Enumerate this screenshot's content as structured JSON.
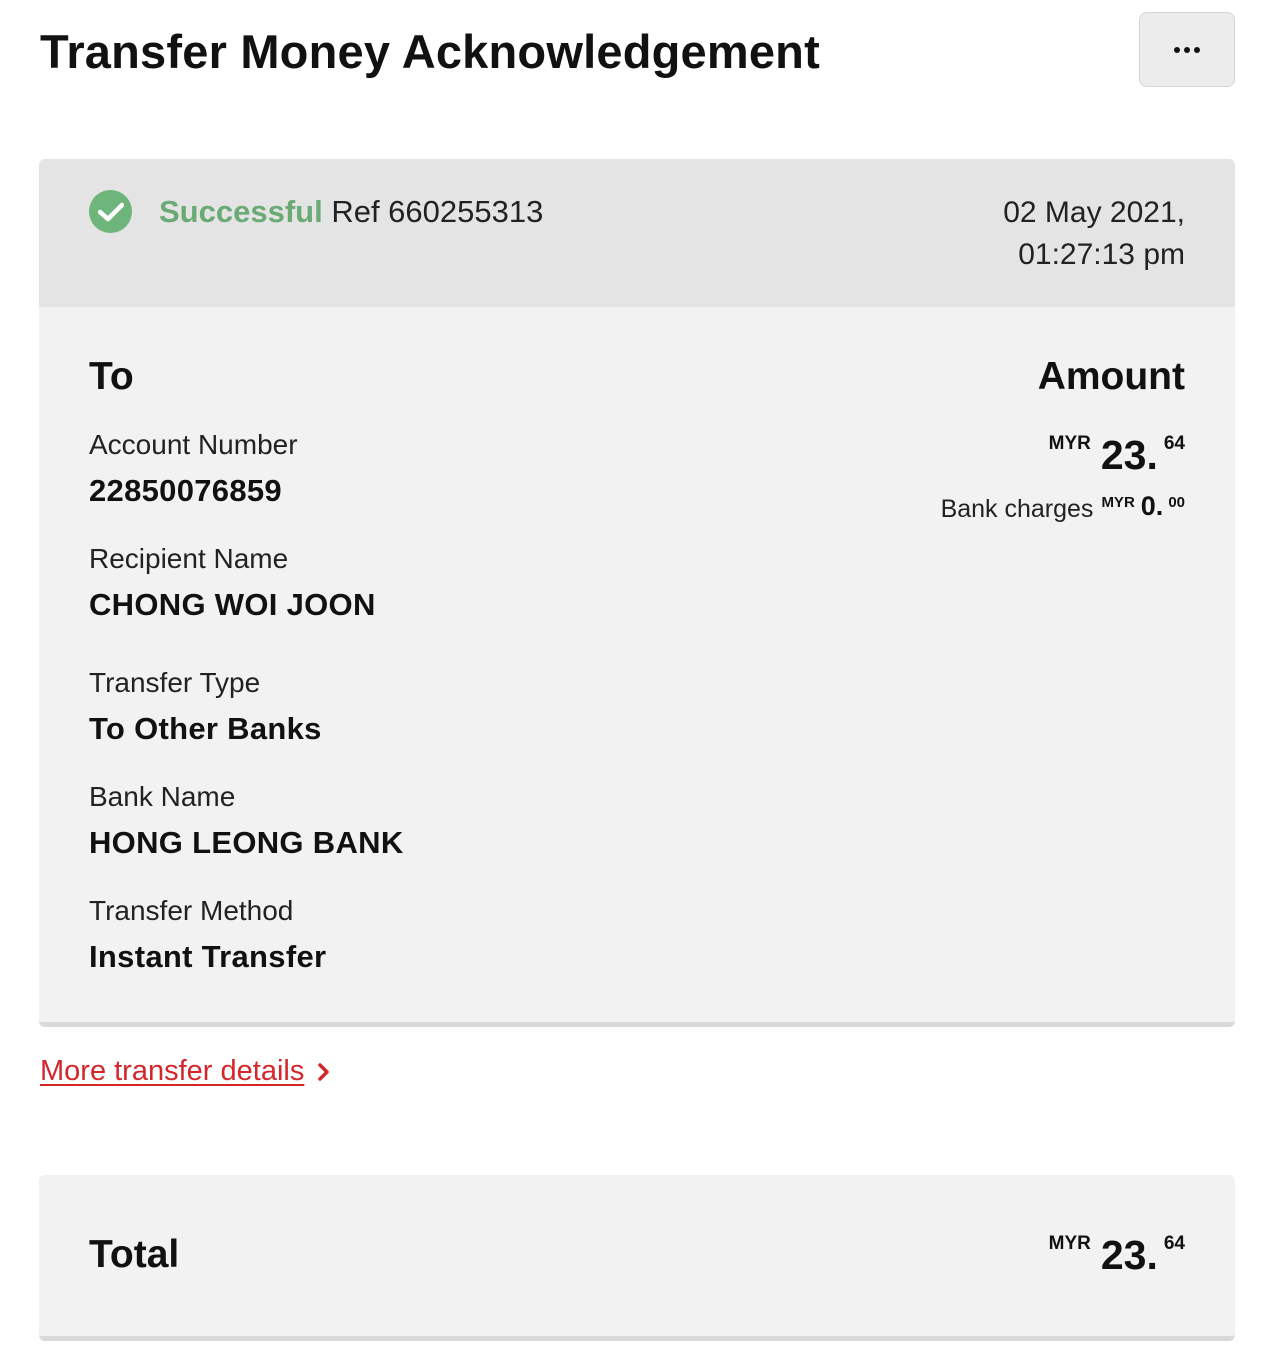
{
  "header": {
    "title": "Transfer Money Acknowledgement",
    "more_icon": "more-horizontal-icon"
  },
  "status": {
    "icon": "check-circle-icon",
    "state": "Successful",
    "reference": "Ref 660255313",
    "date": "02 May 2021,",
    "time": "01:27:13 pm",
    "color": "#6aaa74"
  },
  "details": {
    "to_heading": "To",
    "amount_heading": "Amount",
    "fields": [
      {
        "label": "Account Number",
        "value": "22850076859"
      },
      {
        "label": "Recipient Name",
        "value": "CHONG WOI JOON"
      },
      {
        "label": "Transfer Type",
        "value": "To Other Banks"
      },
      {
        "label": "Bank Name",
        "value": "HONG LEONG BANK"
      },
      {
        "label": "Transfer Method",
        "value": "Instant Transfer"
      }
    ],
    "amount": {
      "currency": "MYR",
      "integer": "23.",
      "decimal": "64"
    },
    "bank_charges": {
      "label": "Bank charges",
      "currency": "MYR",
      "integer": "0.",
      "decimal": "00"
    }
  },
  "more_link": {
    "label": "More transfer details",
    "icon": "chevron-right-icon",
    "color": "#d4272c"
  },
  "total": {
    "label": "Total",
    "currency": "MYR",
    "integer": "23.",
    "decimal": "64"
  }
}
